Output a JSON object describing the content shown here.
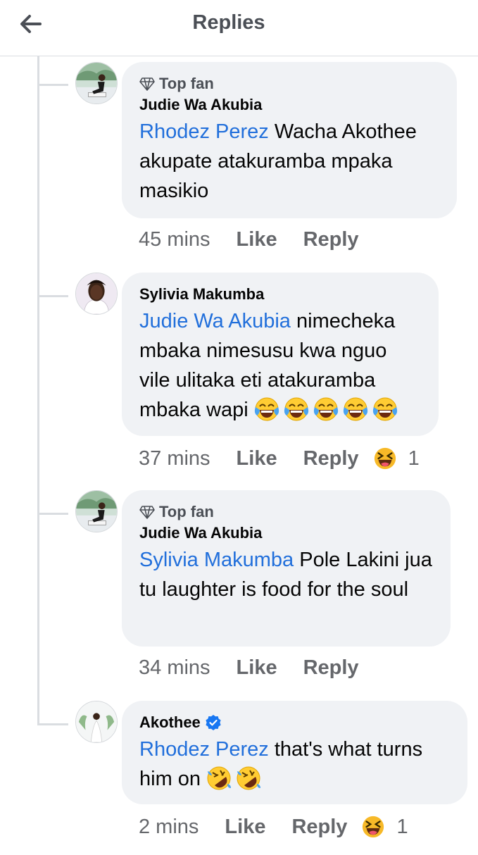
{
  "header": {
    "title": "Replies",
    "back_icon": "arrow-left-icon"
  },
  "badge_label": "Top fan",
  "colors": {
    "mention": "#216fdb",
    "bubble": "#f0f2f5",
    "muted": "#65676b",
    "verified": "#1877f2"
  },
  "comments": [
    {
      "badge": "Top fan",
      "author": "Judie Wa Akubia",
      "mention": "Rhodez Perez",
      "text": " Wacha Akothee akupate  atakuramba mpaka masikio",
      "time": "45 mins",
      "like": "Like",
      "reply": "Reply"
    },
    {
      "author": "Sylivia Makumba",
      "mention": "Judie Wa Akubia",
      "text": " nimecheka mbaka nimesusu kwa nguo vile ulitaka eti atakuramba mbaka wapi ",
      "emoji": "tears-of-joy x5",
      "time": "37 mins",
      "like": "Like",
      "reply": "Reply",
      "reaction_count": "1"
    },
    {
      "badge": "Top fan",
      "author": "Judie Wa Akubia",
      "mention": "Sylivia Makumba",
      "text": " Pole Lakini jua  tu laughter is food for the soul",
      "time": "34 mins",
      "like": "Like",
      "reply": "Reply"
    },
    {
      "author": "Akothee",
      "verified": true,
      "mention": "Rhodez Perez",
      "text": " that's what turns him on ",
      "emoji": "rolling-laughing x2",
      "time": "2 mins",
      "like": "Like",
      "reply": "Reply",
      "reaction_count": "1"
    }
  ]
}
